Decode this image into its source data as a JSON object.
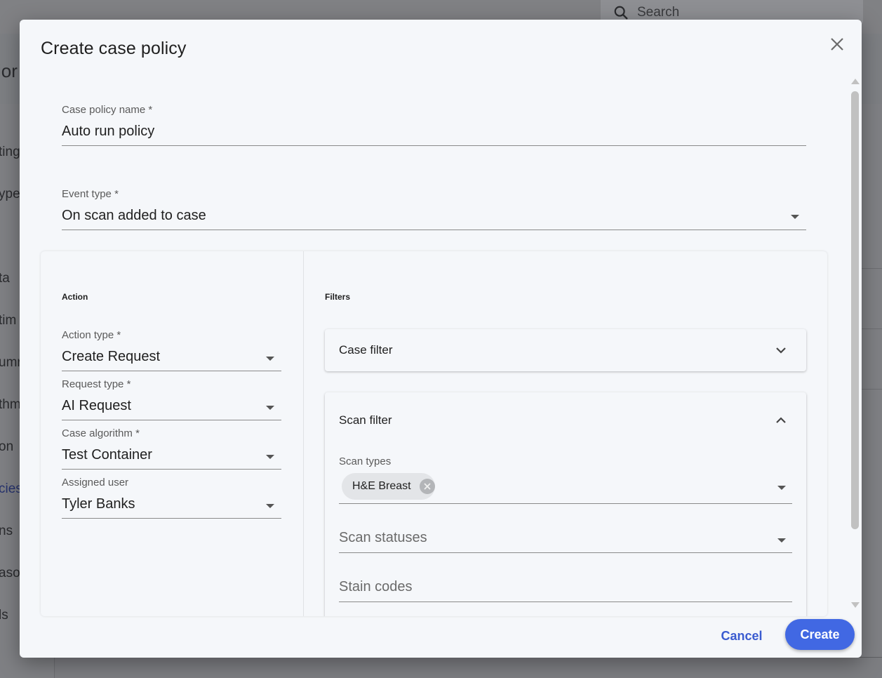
{
  "background": {
    "search_placeholder": "Search",
    "title_fragment": "ior",
    "sidebar_fragments": [
      "ting",
      "ypes",
      "ta",
      "tim",
      "umr",
      "thm",
      "on",
      "cies",
      "ns",
      "aso",
      "ls"
    ]
  },
  "dialog": {
    "title": "Create case policy",
    "case_policy_name": {
      "label": "Case policy name",
      "required": "*",
      "value": "Auto run policy"
    },
    "event_type": {
      "label": "Event type",
      "required": "*",
      "value": "On scan added to case"
    },
    "action": {
      "section_title": "Action",
      "action_type": {
        "label": "Action type",
        "required": "*",
        "value": "Create Request"
      },
      "request_type": {
        "label": "Request type",
        "required": "*",
        "value": "AI Request"
      },
      "case_algorithm": {
        "label": "Case algorithm",
        "required": "*",
        "value": "Test Container"
      },
      "assigned_user": {
        "label": "Assigned user",
        "value": "Tyler Banks"
      }
    },
    "filters": {
      "section_title": "Filters",
      "case_filter": {
        "title": "Case filter"
      },
      "scan_filter": {
        "title": "Scan filter",
        "scan_types": {
          "label": "Scan types",
          "chips": [
            "H&E Breast"
          ]
        },
        "scan_statuses": {
          "placeholder": "Scan statuses"
        },
        "stain_codes": {
          "placeholder": "Stain codes"
        }
      }
    },
    "footer": {
      "cancel_label": "Cancel",
      "create_label": "Create"
    }
  },
  "colors": {
    "primary": "#4168e3",
    "link": "#3a5bd0",
    "dialog_bg": "#f5f7fa",
    "overlay": "#7d7f83"
  }
}
